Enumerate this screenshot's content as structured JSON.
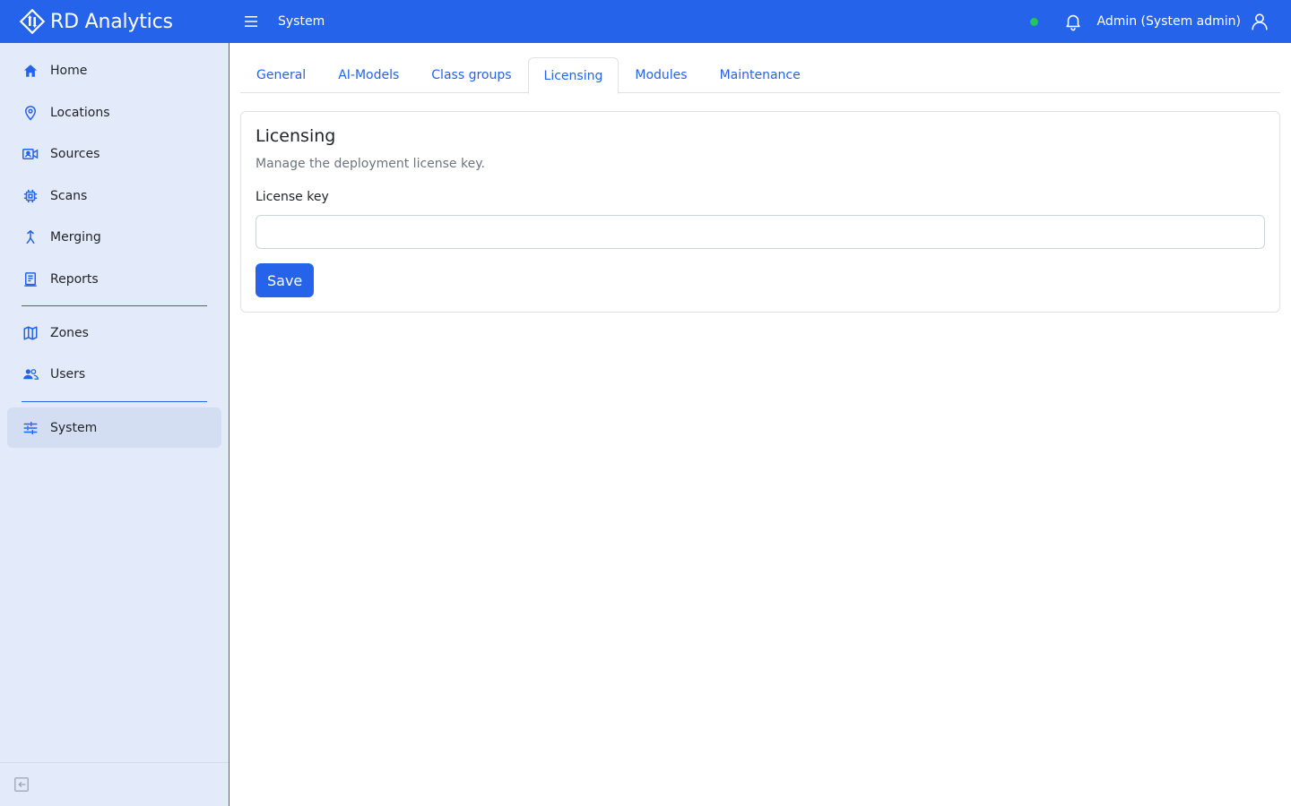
{
  "app": {
    "brand_name": "RD Analytics",
    "page_name": "System"
  },
  "header": {
    "status": "online",
    "user_label": "Admin (System admin)"
  },
  "sidebar": {
    "items": [
      {
        "label": "Home",
        "icon": "home-icon"
      },
      {
        "label": "Locations",
        "icon": "map-pin-icon"
      },
      {
        "label": "Sources",
        "icon": "camera-icon"
      },
      {
        "label": "Scans",
        "icon": "chip-icon"
      },
      {
        "label": "Merging",
        "icon": "merge-icon"
      },
      {
        "label": "Reports",
        "icon": "report-icon"
      },
      {
        "label": "Zones",
        "icon": "map-icon"
      },
      {
        "label": "Users",
        "icon": "users-icon"
      },
      {
        "label": "System",
        "icon": "sliders-icon",
        "active": true
      }
    ]
  },
  "tabs": [
    {
      "label": "General"
    },
    {
      "label": "AI-Models"
    },
    {
      "label": "Class groups"
    },
    {
      "label": "Licensing",
      "active": true
    },
    {
      "label": "Modules"
    },
    {
      "label": "Maintenance"
    }
  ],
  "licensing": {
    "title": "Licensing",
    "description": "Manage the deployment license key.",
    "field_label": "License key",
    "field_value": "",
    "save_label": "Save"
  },
  "colors": {
    "primary": "#2563eb",
    "sidebar_bg": "#e3ebfa",
    "status_online": "#22c55e"
  }
}
